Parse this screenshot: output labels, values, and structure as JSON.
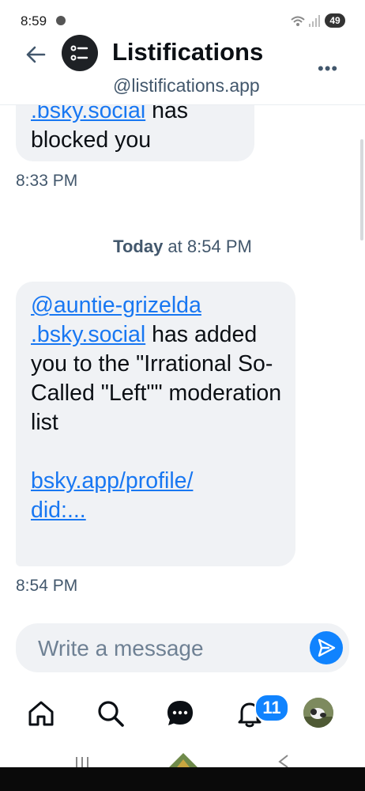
{
  "status_bar": {
    "time": "8:59",
    "battery": "49"
  },
  "header": {
    "title": "Listifications",
    "handle": "@listifications.app"
  },
  "messages": [
    {
      "partial_link": ".bsky.social",
      "rest": " has blocked you",
      "time": "8:33 PM"
    },
    {
      "link1a": "@auntie-grizelda",
      "link1b": ".bsky.social",
      "text_after": " has added you to the \"Irrational So-Called \"Left\"\" moderation list",
      "link2a": "bsky.app/profile/",
      "link2b": "did:...",
      "time": "8:54 PM"
    }
  ],
  "day_separator": {
    "day": "Today",
    "connector": " at ",
    "time": "8:54 PM"
  },
  "composer": {
    "placeholder": "Write a message"
  },
  "nav": {
    "notifications_badge": "11"
  }
}
